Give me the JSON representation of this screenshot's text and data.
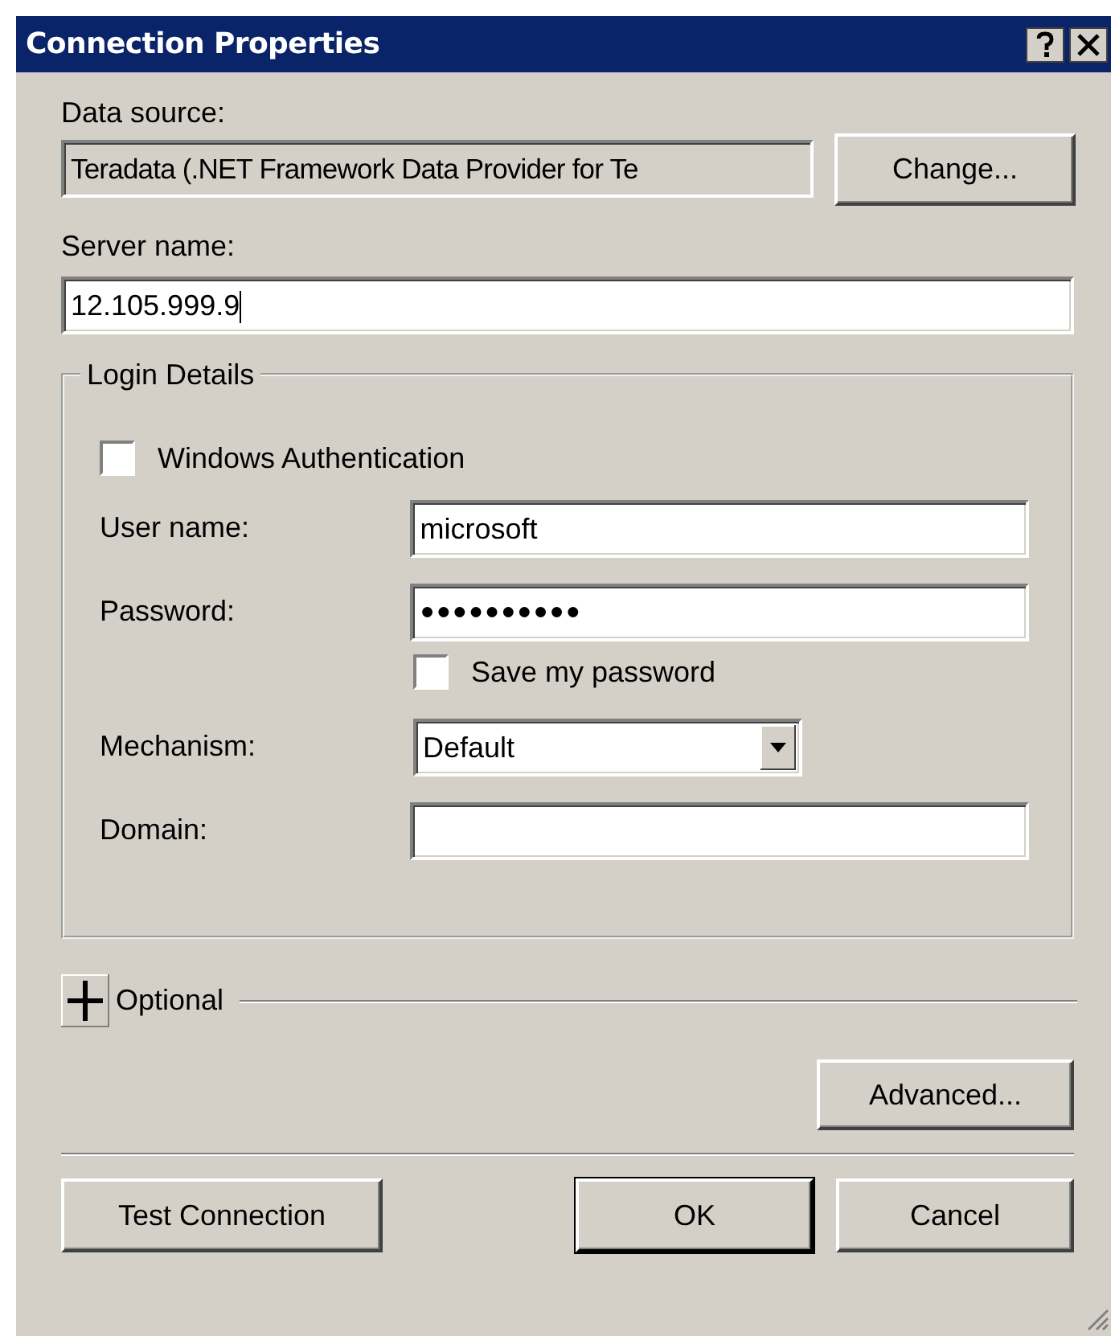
{
  "window": {
    "title": "Connection Properties"
  },
  "data_source": {
    "label": "Data source:",
    "value": "Teradata (.NET Framework Data Provider for Te",
    "button": "Change..."
  },
  "server": {
    "label": "Server name:",
    "value": "12.105.999.9"
  },
  "login": {
    "title": "Login Details",
    "windows_auth": {
      "label": "Windows Authentication",
      "checked": false
    },
    "user": {
      "label": "User name:",
      "value": "microsoft"
    },
    "password": {
      "label": "Password:",
      "value": "●●●●●●●●●●"
    },
    "save_password": {
      "label": "Save my password",
      "checked": false
    },
    "mechanism": {
      "label": "Mechanism:",
      "value": "Default"
    },
    "domain": {
      "label": "Domain:"
    }
  },
  "optional": {
    "label": "Optional",
    "expanded": false
  },
  "buttons": {
    "advanced": "Advanced...",
    "test": "Test Connection",
    "ok": "OK",
    "cancel": "Cancel"
  }
}
